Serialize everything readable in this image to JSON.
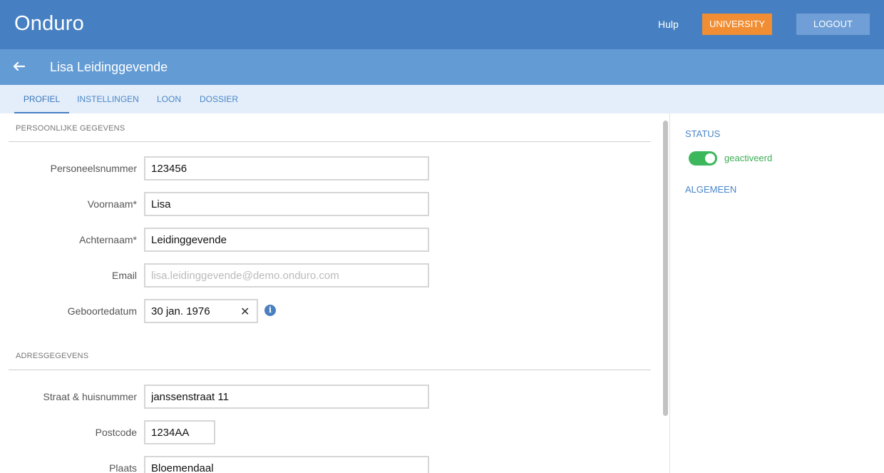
{
  "header": {
    "app_title": "Onduro",
    "help_label": "Hulp",
    "university_label": "UNIVERSITY",
    "logout_label": "LOGOUT",
    "colors": {
      "primary": "#4680c2",
      "accent": "#f18d32",
      "secondary": "#6f9fd6"
    }
  },
  "subheader": {
    "back_icon": "arrow-left-icon",
    "person_name": "Lisa Leidinggevende"
  },
  "tabs": [
    {
      "label": "PROFIEL",
      "active": true
    },
    {
      "label": "INSTELLINGEN",
      "active": false
    },
    {
      "label": "LOON",
      "active": false
    },
    {
      "label": "DOSSIER",
      "active": false
    }
  ],
  "personal": {
    "section_title": "PERSOONLIJKE GEGEVENS",
    "personeelsnummer_label": "Personeelsnummer",
    "personeelsnummer_value": "123456",
    "voornaam_label": "Voornaam*",
    "voornaam_value": "Lisa",
    "achternaam_label": "Achternaam*",
    "achternaam_value": "Leidinggevende",
    "email_label": "Email",
    "email_value": "lisa.leidinggevende@demo.onduro.com",
    "geboortedatum_label": "Geboortedatum",
    "geboortedatum_value": "30 jan. 1976",
    "clear_symbol": "✕",
    "info_symbol": "i"
  },
  "address": {
    "section_title": "ADRESGEGEVENS",
    "straat_label": "Straat & huisnummer",
    "straat_value": "janssenstraat 11",
    "postcode_label": "Postcode",
    "postcode_value": "1234AA",
    "plaats_label": "Plaats",
    "plaats_value": "Bloemendaal"
  },
  "sidebar": {
    "status_heading": "STATUS",
    "status_text": "geactiveerd",
    "status_on": true,
    "status_color": "#3cb75c",
    "general_heading": "ALGEMEEN"
  }
}
